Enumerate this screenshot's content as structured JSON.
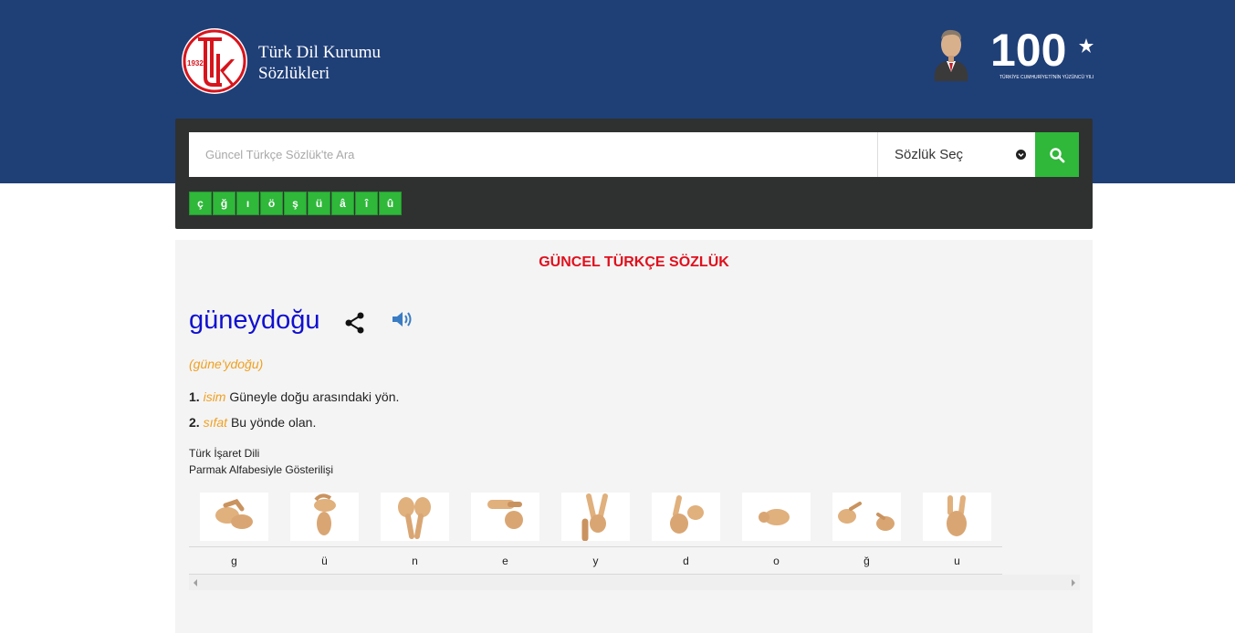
{
  "header": {
    "logo_year": "1932",
    "brand_line1": "Türk Dil Kurumu",
    "brand_line2": "Sözlükleri",
    "centennial_number": "100",
    "centennial_caption": "TÜRKİYE CUMHURİYETİ'NİN YÜZÜNCÜ YILI",
    "bg_color": "#1f3f77"
  },
  "search": {
    "placeholder": "Güncel Türkçe Sözlük'te Ara",
    "dictionary_select": "Sözlük Seç",
    "search_icon": "search-icon",
    "accent_color": "#2fb83a"
  },
  "special_chars": [
    "ç",
    "ğ",
    "ı",
    "ö",
    "ş",
    "ü",
    "â",
    "î",
    "û"
  ],
  "result": {
    "dictionary_title": "GÜNCEL TÜRKÇE SÖZLÜK",
    "word": "güneydoğu",
    "share_icon": "share-icon",
    "audio_icon": "speaker-icon",
    "pronunciation": "(güne'ydoğu)",
    "meanings": [
      {
        "num": "1.",
        "type": "isim",
        "text": "Güneyle doğu arasındaki yön."
      },
      {
        "num": "2.",
        "type": "sıfat",
        "text": "Bu yönde olan."
      }
    ]
  },
  "sign_language": {
    "line1": "Türk İşaret Dili",
    "line2": "Parmak Alfabesiyle Gösterilişi",
    "letters": [
      "g",
      "ü",
      "n",
      "e",
      "y",
      "d",
      "o",
      "ğ",
      "u"
    ]
  }
}
